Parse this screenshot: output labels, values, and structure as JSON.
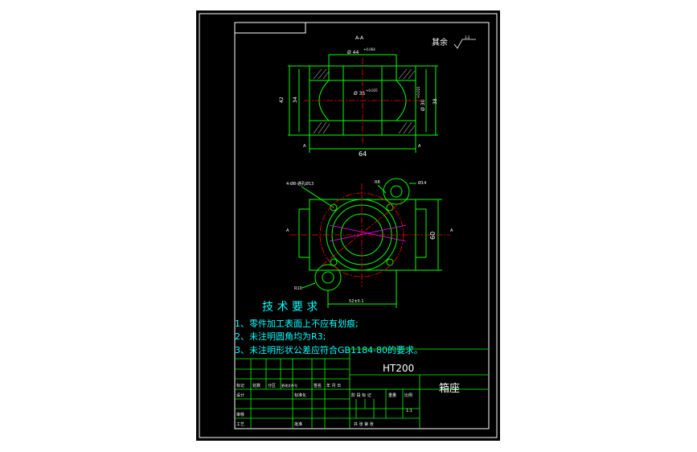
{
  "section_label": "A-A",
  "roughness_note": "其余",
  "roughness_value": "3.2",
  "dims_top": {
    "bore_top": "Ø 44",
    "bore_top_tol": "+0.064",
    "bore_mid": "Ø 35",
    "bore_mid_tol": "+0.025",
    "left_outer": "42",
    "left_inner": "34",
    "right_inner": "Ø 30",
    "right_inner_tol": "+0.021",
    "right_outer": "38",
    "width": "64",
    "section_mark_left": "A",
    "section_mark_right": "A"
  },
  "dims_bottom": {
    "hole_callout": "4-Ø8-通孔Ø13",
    "r_top": "R8",
    "d_right": "Ø14",
    "height": "60",
    "r_bottom": "R10",
    "width": "52±0.1",
    "view_mark_left": "A",
    "view_mark_right": "A"
  },
  "tech_requirements": {
    "title": "技 术 要 求",
    "items": [
      "1、零件加工表面上不应有划痕;",
      "2、未注明圆角均为R3;",
      "3、未注明形状公差应符合GB1184-80的要求。"
    ]
  },
  "title_block": {
    "material": "HT200",
    "part_name": "箱座",
    "scale": "1:1",
    "row1": [
      "标记",
      "处数",
      "分区",
      "更改文件号",
      "签名",
      "年 月 日"
    ],
    "designer": "设计",
    "standardize": "标准化",
    "stage": "阶 段 标 记",
    "weight": "重量",
    "scale_label": "比例",
    "review": "审核",
    "craft": "工艺",
    "approve": "批准",
    "sheets": "共   张  第   张"
  }
}
